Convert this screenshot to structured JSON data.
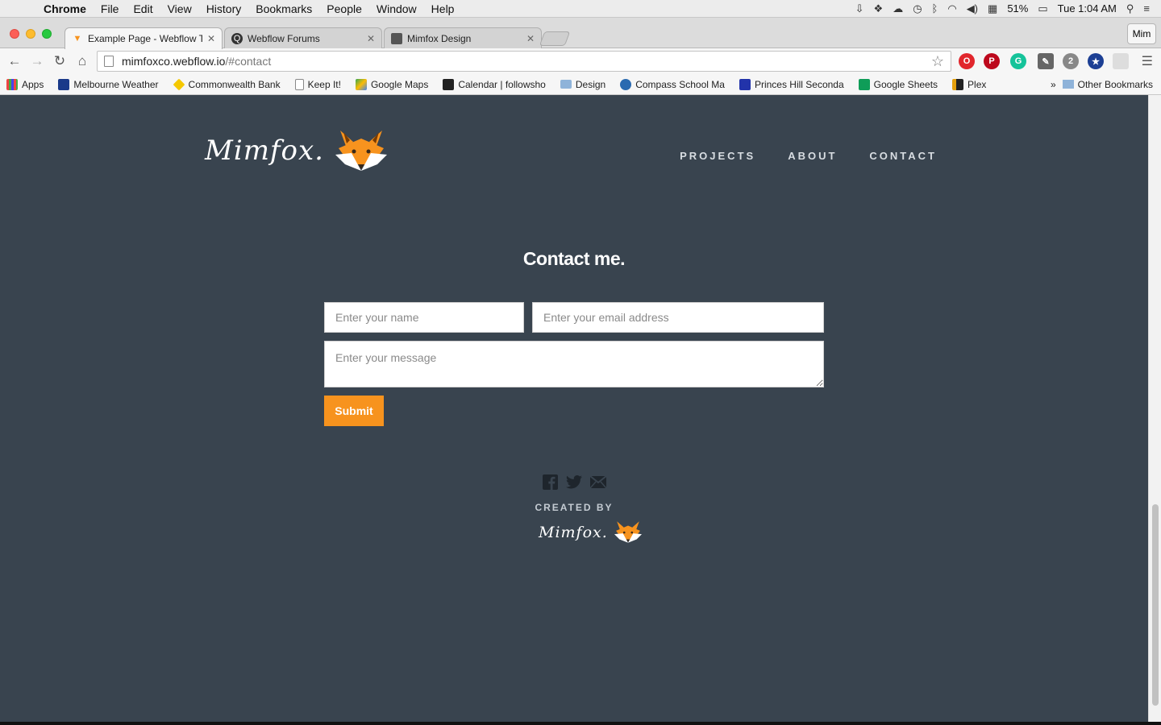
{
  "os_menubar": {
    "app_name": "Chrome",
    "menus": [
      "File",
      "Edit",
      "View",
      "History",
      "Bookmarks",
      "People",
      "Window",
      "Help"
    ],
    "battery": "51%",
    "clock": "Tue 1:04 AM"
  },
  "browser": {
    "tabs": [
      {
        "title": "Example Page - Webflow T",
        "active": true
      },
      {
        "title": "Webflow Forums",
        "active": false
      },
      {
        "title": "Mimfox Design",
        "active": false
      }
    ],
    "profile": "Mim",
    "url_host": "mimfoxco.webflow.io",
    "url_path": "/#contact",
    "bookmarks": [
      {
        "label": "Apps",
        "color": "#e44"
      },
      {
        "label": "Melbourne Weather",
        "color": "#1a3a8a"
      },
      {
        "label": "Commonwealth Bank",
        "color": "#f5c800"
      },
      {
        "label": "Keep It!",
        "color": "#ffffff"
      },
      {
        "label": "Google Maps",
        "color": "#34a853"
      },
      {
        "label": "Calendar | followsho",
        "color": "#222222"
      },
      {
        "label": "Design",
        "color": "#8fb3d9"
      },
      {
        "label": "Compass School Ma",
        "color": "#2a6ab0"
      },
      {
        "label": "Princes Hill Seconda",
        "color": "#2233aa"
      },
      {
        "label": "Google Sheets",
        "color": "#0f9d58"
      },
      {
        "label": "Plex",
        "color": "#e5a00d"
      }
    ],
    "overflow": "»",
    "other_bookmarks": "Other Bookmarks"
  },
  "page": {
    "logo_text": "Mimfox.",
    "nav": [
      "PROJECTS",
      "ABOUT",
      "CONTACT"
    ],
    "heading": "Contact me.",
    "form": {
      "name_placeholder": "Enter your name",
      "email_placeholder": "Enter your email address",
      "message_placeholder": "Enter your message",
      "submit_label": "Submit"
    },
    "footer": {
      "created_by": "CREATED BY",
      "logo_text": "Mimfox."
    },
    "colors": {
      "background": "#39444f",
      "accent": "#f7931e"
    }
  }
}
